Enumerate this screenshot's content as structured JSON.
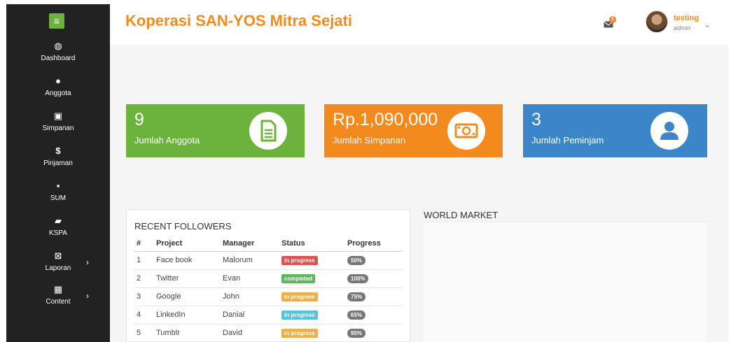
{
  "sidebar": {
    "toggle_icon": "hamburger-icon",
    "items": [
      {
        "label": "Dashboard",
        "icon": "dashboard-icon",
        "active": true
      },
      {
        "label": "Anggota",
        "icon": "user-icon"
      },
      {
        "label": "Simpanan",
        "icon": "money-icon"
      },
      {
        "label": "Pinjaman",
        "icon": "dollar-icon"
      },
      {
        "label": "SUM",
        "icon": "file-icon"
      },
      {
        "label": "KSPA",
        "icon": "book-icon"
      },
      {
        "label": "Laporan",
        "icon": "excel-file-icon",
        "has_submenu": true
      },
      {
        "label": "Content",
        "icon": "calendar-icon",
        "has_submenu": true
      }
    ],
    "glyphs": {
      "dashboard": "◍",
      "user": "●",
      "money": "▣",
      "dollar": "$",
      "file": "▪",
      "book": "▰",
      "excel": "⊠",
      "calendar": "▦",
      "chevron": "›"
    }
  },
  "header": {
    "brand": "Koperasi SAN-YOS Mitra Sejati",
    "mail_badge": "1",
    "user_name": "testing",
    "user_role": "admin",
    "chevron": "⌄"
  },
  "cards": [
    {
      "value": "9",
      "label": "Jumlah Anggota",
      "icon": "document-icon",
      "color": "#6cb33e"
    },
    {
      "value": "Rp.1,090,000",
      "label": "Jumlah Simpanan",
      "icon": "money-bill-icon",
      "color": "#f38a1e"
    },
    {
      "value": "3",
      "label": "Jumlah Peminjam",
      "icon": "user-circle-icon",
      "color": "#3a86c8"
    }
  ],
  "followers": {
    "title": "RECENT FOLLOWERS",
    "columns": [
      "#",
      "Project",
      "Manager",
      "Status",
      "Progress"
    ],
    "rows": [
      {
        "n": "1",
        "project": "Face book",
        "manager": "Malorum",
        "status": "in progress",
        "status_color": "#d9534f",
        "progress": "50%"
      },
      {
        "n": "2",
        "project": "Twitter",
        "manager": "Evan",
        "status": "completed",
        "status_color": "#5cb85c",
        "progress": "100%"
      },
      {
        "n": "3",
        "project": "Google",
        "manager": "John",
        "status": "in progress",
        "status_color": "#f0ad4e",
        "progress": "75%"
      },
      {
        "n": "4",
        "project": "LinkedIn",
        "manager": "Danial",
        "status": "in progress",
        "status_color": "#5bc0de",
        "progress": "65%"
      },
      {
        "n": "5",
        "project": "Tumblr",
        "manager": "David",
        "status": "in progress",
        "status_color": "#f0ad4e",
        "progress": "95%"
      }
    ]
  },
  "world_market": {
    "title": "WORLD MARKET"
  }
}
